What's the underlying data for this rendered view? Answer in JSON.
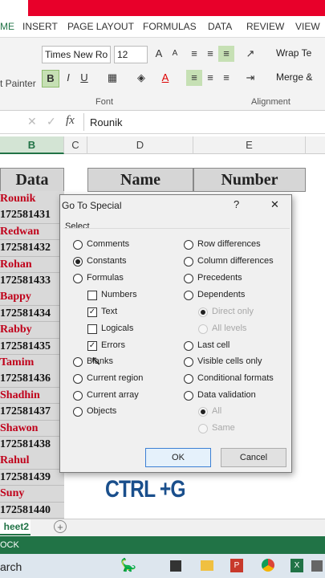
{
  "ribbon": {
    "tabs": [
      "ME",
      "INSERT",
      "PAGE LAYOUT",
      "FORMULAS",
      "DATA",
      "REVIEW",
      "VIEW"
    ],
    "font_name": "Times New Ro",
    "font_size": "12",
    "format_painter": "t Painter",
    "wrap_text": "Wrap Te",
    "merge": "Merge &",
    "group_font": "Font",
    "group_alignment": "Alignment",
    "bold": "B",
    "italic": "I",
    "underline": "U",
    "font_color_glyph": "A"
  },
  "formula_bar": {
    "fx": "fx",
    "value": "Rounik"
  },
  "columns": [
    "B",
    "C",
    "D",
    "E"
  ],
  "sheet": {
    "header_data": "Data",
    "header_name": "Name",
    "header_number": "Number",
    "column_b": [
      {
        "text": "Rounik",
        "color": "#c0001a"
      },
      {
        "text": "172581431",
        "color": "#111111"
      },
      {
        "text": "Redwan",
        "color": "#c0001a"
      },
      {
        "text": "172581432",
        "color": "#111111"
      },
      {
        "text": "Rohan",
        "color": "#c0001a"
      },
      {
        "text": "172581433",
        "color": "#111111"
      },
      {
        "text": "Bappy",
        "color": "#c0001a"
      },
      {
        "text": "172581434",
        "color": "#111111"
      },
      {
        "text": "Rabby",
        "color": "#c0001a"
      },
      {
        "text": "172581435",
        "color": "#111111"
      },
      {
        "text": "Tamim",
        "color": "#c0001a"
      },
      {
        "text": "172581436",
        "color": "#111111"
      },
      {
        "text": "Shadhin",
        "color": "#c0001a"
      },
      {
        "text": "172581437",
        "color": "#111111"
      },
      {
        "text": "Shawon",
        "color": "#c0001a"
      },
      {
        "text": "172581438",
        "color": "#111111"
      },
      {
        "text": "Rahul",
        "color": "#c0001a"
      },
      {
        "text": "172581439",
        "color": "#111111"
      },
      {
        "text": "Suny",
        "color": "#c0001a"
      },
      {
        "text": "172581440",
        "color": "#111111"
      }
    ],
    "overlay_text": "CTRL +G",
    "tab_name": "heet2",
    "status": "OCK",
    "taskbar_search": "arch"
  },
  "dialog": {
    "title": "Go To Special",
    "help": "?",
    "close": "✕",
    "select_label": "Select",
    "left_options": [
      {
        "label": "Comments",
        "type": "radio",
        "checked": false
      },
      {
        "label": "Constants",
        "type": "radio",
        "checked": true
      },
      {
        "label": "Formulas",
        "type": "radio",
        "checked": false
      },
      {
        "label": "Numbers",
        "type": "check",
        "checked": false
      },
      {
        "label": "Text",
        "type": "check",
        "checked": true
      },
      {
        "label": "Logicals",
        "type": "check",
        "checked": false
      },
      {
        "label": "Errors",
        "type": "check",
        "checked": true
      },
      {
        "label": "Blanks",
        "type": "radio",
        "checked": false
      },
      {
        "label": "Current region",
        "type": "radio",
        "checked": false
      },
      {
        "label": "Current array",
        "type": "radio",
        "checked": false
      },
      {
        "label": "Objects",
        "type": "radio",
        "checked": false
      }
    ],
    "right_options": [
      {
        "label": "Row differences",
        "type": "radio",
        "checked": false,
        "disabled": false
      },
      {
        "label": "Column differences",
        "type": "radio",
        "checked": false,
        "disabled": false
      },
      {
        "label": "Precedents",
        "type": "radio",
        "checked": false,
        "disabled": false
      },
      {
        "label": "Dependents",
        "type": "radio",
        "checked": false,
        "disabled": false
      },
      {
        "label": "Direct only",
        "type": "radio",
        "checked": true,
        "disabled": true
      },
      {
        "label": "All levels",
        "type": "radio",
        "checked": false,
        "disabled": true
      },
      {
        "label": "Last cell",
        "type": "radio",
        "checked": false,
        "disabled": false
      },
      {
        "label": "Visible cells only",
        "type": "radio",
        "checked": false,
        "disabled": false
      },
      {
        "label": "Conditional formats",
        "type": "radio",
        "checked": false,
        "disabled": false
      },
      {
        "label": "Data validation",
        "type": "radio",
        "checked": false,
        "disabled": false
      },
      {
        "label": "All",
        "type": "radio",
        "checked": true,
        "disabled": true
      },
      {
        "label": "Same",
        "type": "radio",
        "checked": false,
        "disabled": true
      }
    ],
    "ok_label": "OK",
    "cancel_label": "Cancel"
  },
  "colors": {
    "ribbon_red": "#e8002a",
    "status_green": "#217346",
    "name_red": "#c0001a",
    "overlay_blue": "#1a4f8c"
  }
}
